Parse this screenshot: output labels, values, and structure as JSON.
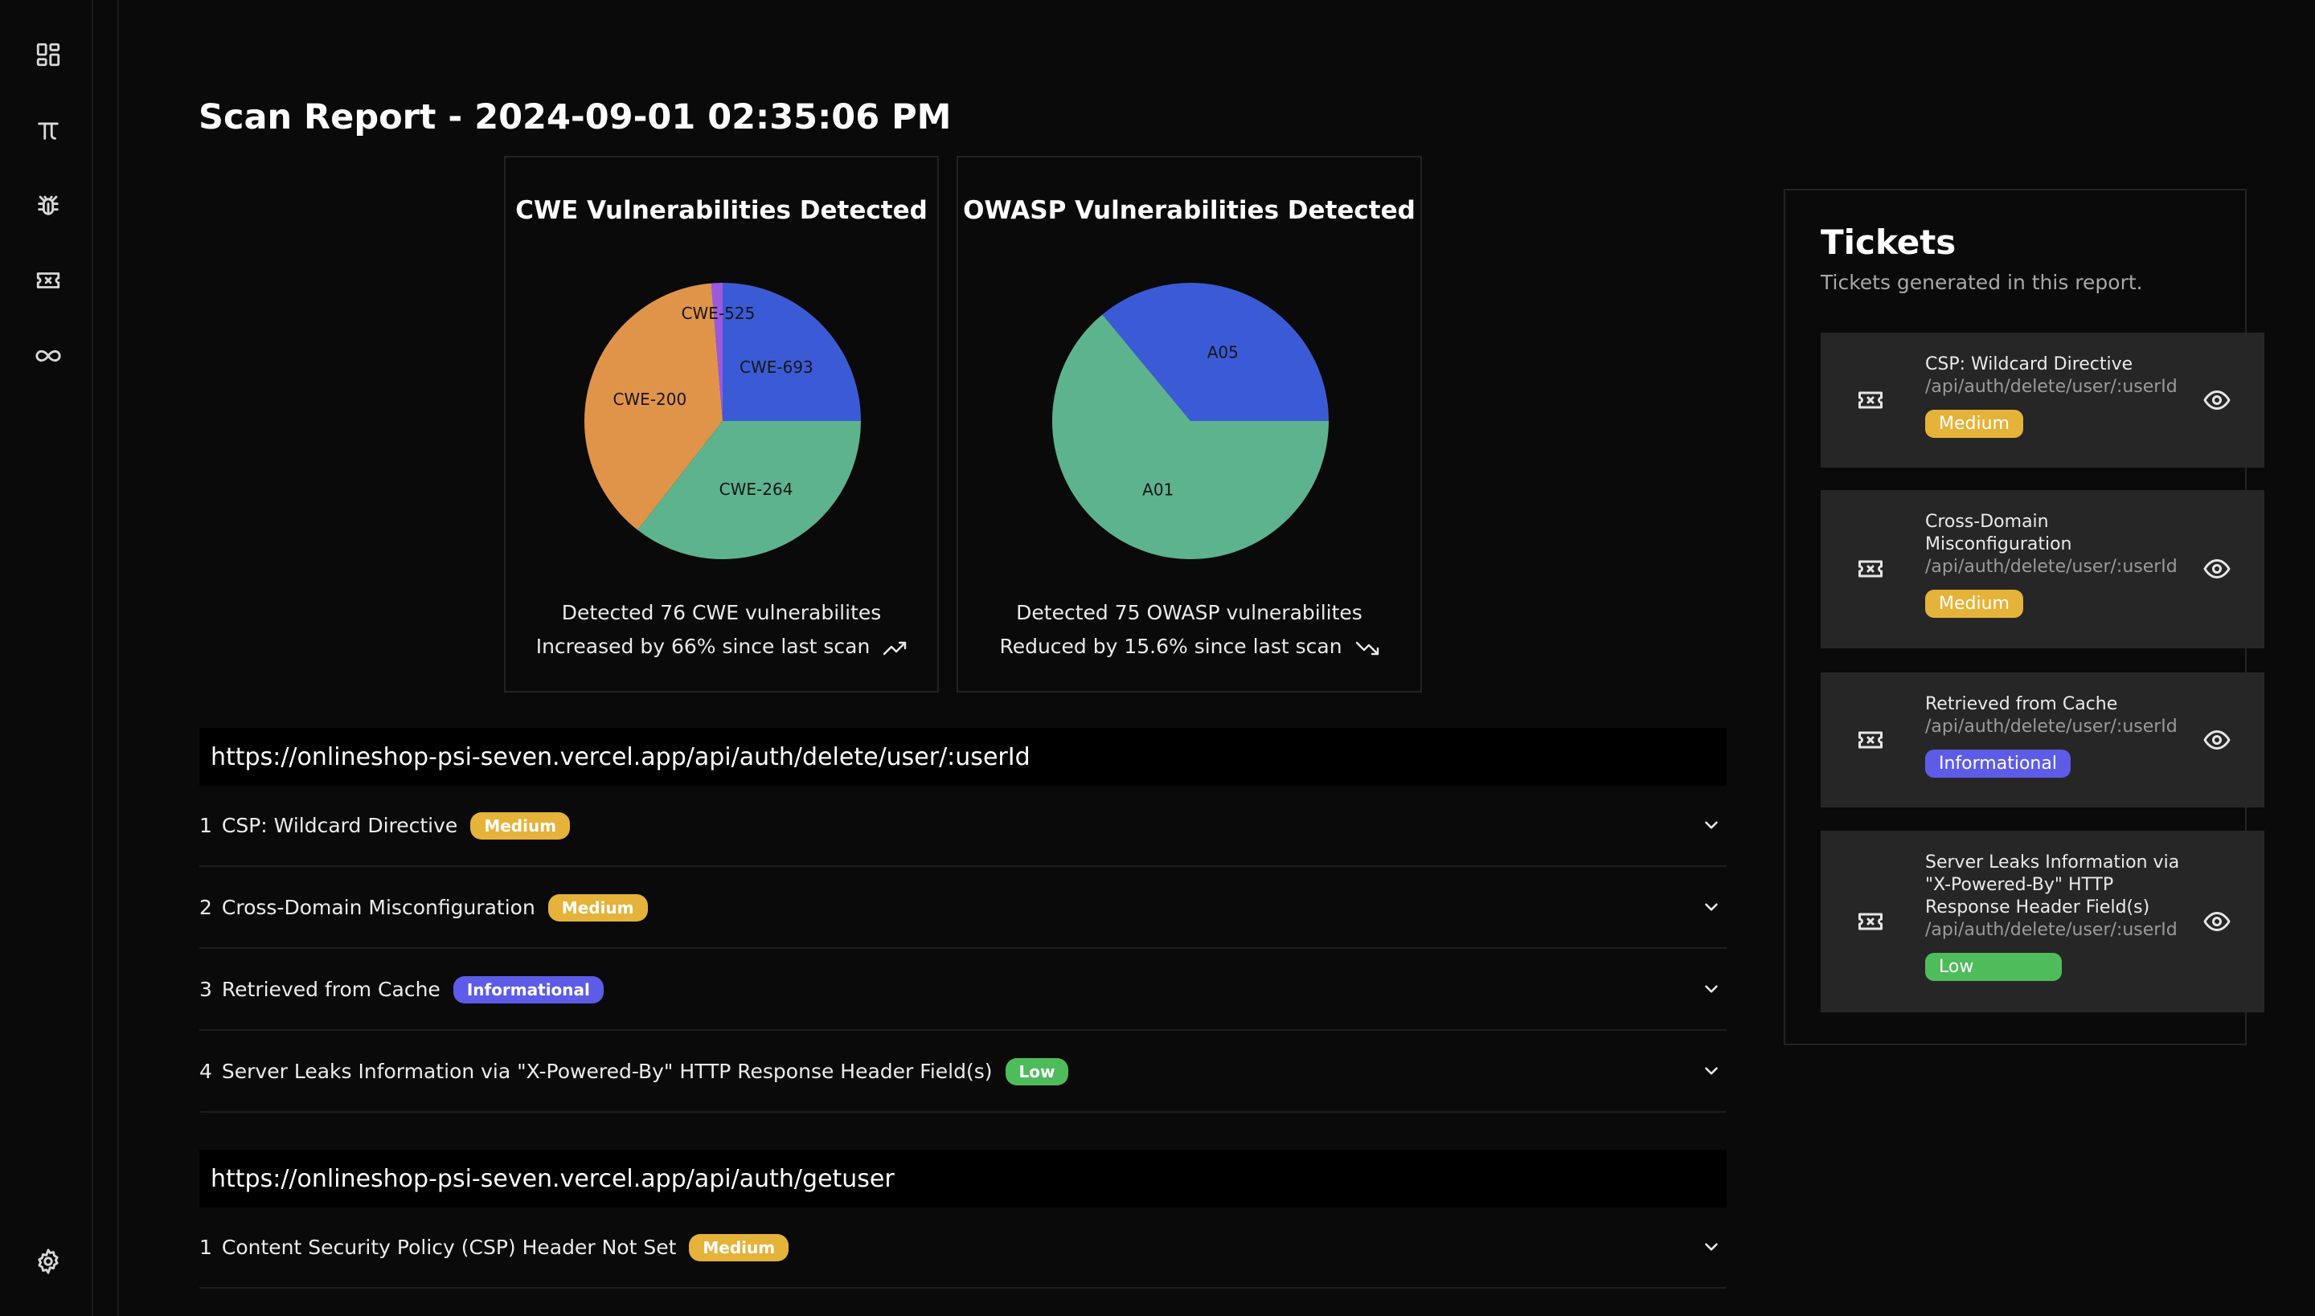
{
  "sidebar": {
    "items": [
      {
        "icon": "dashboard-icon"
      },
      {
        "icon": "pi-icon"
      },
      {
        "icon": "bug-icon"
      },
      {
        "icon": "ticket-icon"
      },
      {
        "icon": "infinity-icon"
      }
    ],
    "bottom": {
      "icon": "gear-icon"
    }
  },
  "page": {
    "title": "Scan Report - 2024-09-01 02:35:06 PM"
  },
  "colors": {
    "blue": "#3b5bd6",
    "green": "#5db38e",
    "orange": "#e0944a",
    "purple": "#9b59e0",
    "badge_medium": "#e5b23a",
    "badge_informational": "#5d5ce8",
    "badge_low": "#4fbc5c"
  },
  "chart_data": [
    {
      "type": "pie",
      "title": "CWE Vulnerabilities Detected",
      "categories": [
        "CWE-693",
        "CWE-525",
        "CWE-200",
        "CWE-264"
      ],
      "values": [
        19,
        1,
        29,
        27
      ],
      "colors": [
        "#3b5bd6",
        "#9b59e0",
        "#e0944a",
        "#5db38e"
      ],
      "summary": "Detected 76 CWE vulnerabilites",
      "trend": "Increased by 66% since last scan",
      "trend_direction": "up"
    },
    {
      "type": "pie",
      "title": "OWASP Vulnerabilities Detected",
      "categories": [
        "A05",
        "A01"
      ],
      "values": [
        27,
        48
      ],
      "colors": [
        "#3b5bd6",
        "#5db38e"
      ],
      "summary": "Detected 75 OWASP vulnerabilites",
      "trend": "Reduced by 15.6% since last scan",
      "trend_direction": "down"
    }
  ],
  "groups": [
    {
      "url": "https://onlineshop-psi-seven.vercel.app/api/auth/delete/user/:userId",
      "vulns": [
        {
          "num": "1",
          "name": "CSP: Wildcard Directive",
          "severity": "Medium"
        },
        {
          "num": "2",
          "name": "Cross-Domain Misconfiguration",
          "severity": "Medium"
        },
        {
          "num": "3",
          "name": "Retrieved from Cache",
          "severity": "Informational"
        },
        {
          "num": "4",
          "name": "Server Leaks Information via \"X-Powered-By\" HTTP Response Header Field(s)",
          "severity": "Low"
        }
      ]
    },
    {
      "url": "https://onlineshop-psi-seven.vercel.app/api/auth/getuser",
      "vulns": [
        {
          "num": "1",
          "name": "Content Security Policy (CSP) Header Not Set",
          "severity": "Medium"
        }
      ]
    }
  ],
  "tickets": {
    "title": "Tickets",
    "subtitle": "Tickets generated in this report.",
    "items": [
      {
        "name": "CSP: Wildcard Directive",
        "path": "/api/auth/delete/user/:userId",
        "severity": "Medium"
      },
      {
        "name": "Cross-Domain Misconfiguration",
        "path": "/api/auth/delete/user/:userId",
        "severity": "Medium"
      },
      {
        "name": "Retrieved from Cache",
        "path": "/api/auth/delete/user/:userId",
        "severity": "Informational"
      },
      {
        "name": "Server Leaks Information via \"X-Powered-By\" HTTP Response Header Field(s)",
        "path": "/api/auth/delete/user/:userId",
        "severity": "Low"
      }
    ]
  }
}
